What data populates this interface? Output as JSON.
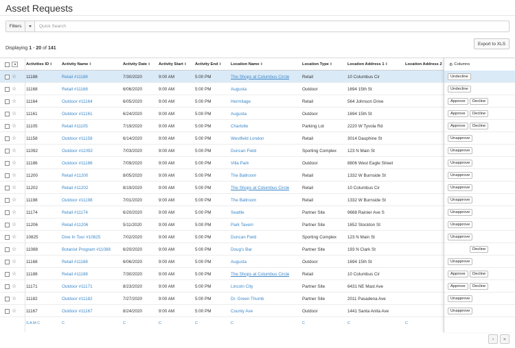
{
  "page": {
    "title": "Asset Requests"
  },
  "toolbar": {
    "filters_label": "Filters",
    "search_placeholder": "Quick Search",
    "export_label": "Export to XLS"
  },
  "display": {
    "prefix": "Displaying",
    "start": "1",
    "sep": "-",
    "end": "20",
    "of": "of",
    "total": "141"
  },
  "columns": [
    "Activities ID",
    "Activity Name",
    "Activity Date",
    "Activity Start",
    "Activity End",
    "Location Name",
    "Location Type",
    "Location Address 1",
    "Location Address 2"
  ],
  "actions_panel": {
    "columns_label": "Columns"
  },
  "rows": [
    {
      "id": "11188",
      "name": "Retail #11188",
      "date": "7/30/2020",
      "start": "9:00 AM",
      "end": "5:00 PM",
      "loc": "The Shops at Columbus Circle",
      "type": "Retail",
      "addr": "10 Columbus Cir",
      "actions": [
        "Undecline"
      ],
      "selected": true
    },
    {
      "id": "11168",
      "name": "Retail #11168",
      "date": "6/06/2020",
      "start": "9:00 AM",
      "end": "5:00 PM",
      "loc": "Augusta",
      "type": "Outdoor",
      "addr": "1694 15th St",
      "actions": [
        "Undecline"
      ]
    },
    {
      "id": "11164",
      "name": "Outdoor #11164",
      "date": "6/05/2020",
      "start": "9:00 AM",
      "end": "5:00 PM",
      "loc": "Hermitage",
      "type": "Retail",
      "addr": "564 Johnson Drive",
      "actions": [
        "Approve",
        "Decline"
      ]
    },
    {
      "id": "11161",
      "name": "Outdoor #11161",
      "date": "6/24/2020",
      "start": "9:00 AM",
      "end": "5:00 PM",
      "loc": "Augusta",
      "type": "Outdoor",
      "addr": "1694 15th St",
      "actions": [
        "Approve",
        "Decline"
      ]
    },
    {
      "id": "11105",
      "name": "Retail #11105",
      "date": "7/19/2020",
      "start": "9:00 AM",
      "end": "5:00 PM",
      "loc": "Charlotte",
      "type": "Parking Lot",
      "addr": "2220 W Tyvola Rd",
      "actions": [
        "Approve",
        "Decline"
      ]
    },
    {
      "id": "11158",
      "name": "Outdoor #11158",
      "date": "6/14/2020",
      "start": "9:00 AM",
      "end": "5:00 PM",
      "loc": "Westfield London",
      "type": "Retail",
      "addr": "3014 Dauphine St",
      "actions": [
        "Unapprove"
      ]
    },
    {
      "id": "11092",
      "name": "Outdoor #11092",
      "date": "7/03/2020",
      "start": "9:00 AM",
      "end": "5:00 PM",
      "loc": "Duncan Field",
      "type": "Sporting Complex",
      "addr": "123 N Main St",
      "actions": [
        "Unapprove"
      ]
    },
    {
      "id": "11186",
      "name": "Outdoor #11186",
      "date": "7/09/2020",
      "start": "9:00 AM",
      "end": "5:00 PM",
      "loc": "Villa Park",
      "type": "Outdoor",
      "addr": "8806 West Eagle Street",
      "actions": [
        "Unapprove"
      ]
    },
    {
      "id": "11200",
      "name": "Retail #11200",
      "date": "8/05/2020",
      "start": "9:00 AM",
      "end": "5:00 PM",
      "loc": "The Ballroom",
      "type": "Retail",
      "addr": "1332 W Burnside St",
      "actions": [
        "Unapprove"
      ]
    },
    {
      "id": "11202",
      "name": "Retail #11202",
      "date": "8/19/2020",
      "start": "9:00 AM",
      "end": "5:00 PM",
      "loc": "The Shops at Columbus Circle",
      "type": "Retail",
      "addr": "10 Columbus Cir",
      "actions": [
        "Unapprove"
      ]
    },
    {
      "id": "11198",
      "name": "Outdoor #11198",
      "date": "7/01/2020",
      "start": "9:00 AM",
      "end": "5:00 PM",
      "loc": "The Ballroom",
      "type": "Retail",
      "addr": "1332 W Burnside St",
      "actions": [
        "Unapprove"
      ]
    },
    {
      "id": "11174",
      "name": "Retail #11174",
      "date": "6/20/2020",
      "start": "9:00 AM",
      "end": "5:00 PM",
      "loc": "Seattle",
      "type": "Partner Site",
      "addr": "9668 Rainier Ave S",
      "actions": [
        "Unapprove"
      ]
    },
    {
      "id": "11206",
      "name": "Retail #11206",
      "date": "5/11/2020",
      "start": "9:00 AM",
      "end": "5:00 PM",
      "loc": "Park Tavern",
      "type": "Partner Site",
      "addr": "1652 Stockton St",
      "actions": [
        "Unapprove"
      ]
    },
    {
      "id": "10825",
      "name": "Dive In Tour #10825",
      "date": "7/02/2020",
      "start": "9:00 AM",
      "end": "5:00 PM",
      "loc": "Duncan Field",
      "type": "Sporting Complex",
      "addr": "123 N Main St",
      "actions": [
        "Unapprove"
      ]
    },
    {
      "id": "11088",
      "name": "Botanist Program #11088",
      "date": "6/20/2020",
      "start": "9:00 AM",
      "end": "5:00 PM",
      "loc": "Doug's Bar",
      "type": "Partner Site",
      "addr": "193 N Clark St",
      "actions": [
        "Decline"
      ]
    },
    {
      "id": "11168",
      "name": "Retail #11168",
      "date": "6/06/2020",
      "start": "9:00 AM",
      "end": "5:00 PM",
      "loc": "Augusta",
      "type": "Outdoor",
      "addr": "1694 15th St",
      "actions": [
        "Unapprove"
      ]
    },
    {
      "id": "11188",
      "name": "Retail #11188",
      "date": "7/30/2020",
      "start": "9:00 AM",
      "end": "5:00 PM",
      "loc": "The Shops at Columbus Circle",
      "type": "Retail",
      "addr": "10 Columbus Cir",
      "actions": [
        "Approve",
        "Decline"
      ]
    },
    {
      "id": "11171",
      "name": "Outdoor #11171",
      "date": "8/23/2020",
      "start": "9:00 AM",
      "end": "5:00 PM",
      "loc": "Lincoln City",
      "type": "Partner Site",
      "addr": "6431 NE Mast Ave",
      "actions": [
        "Approve",
        "Decline"
      ]
    },
    {
      "id": "11182",
      "name": "Outdoor #11182",
      "date": "7/27/2020",
      "start": "9:00 AM",
      "end": "5:00 PM",
      "loc": "Dr. Green Thumb",
      "type": "Partner Site",
      "addr": "2011 Pasadena Ave",
      "actions": [
        "Unapprove"
      ]
    },
    {
      "id": "11167",
      "name": "Outdoor #11167",
      "date": "8/24/2020",
      "start": "9:00 AM",
      "end": "5:00 PM",
      "loc": "County Ave",
      "type": "Outdoor",
      "addr": "1441 Santa Anita Ave",
      "actions": [
        "Unapprove"
      ]
    }
  ],
  "summary": {
    "first": "S A M C",
    "other": "C"
  },
  "pager": {
    "next": "›",
    "last": "»"
  }
}
